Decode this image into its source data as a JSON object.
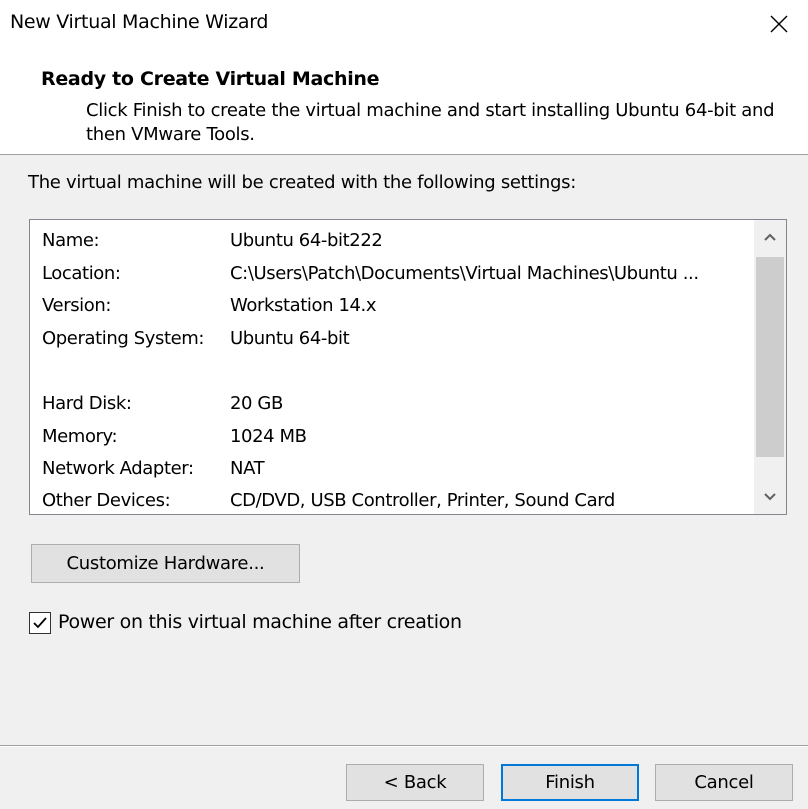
{
  "window": {
    "title": "New Virtual Machine Wizard",
    "close_icon": "close-icon"
  },
  "header": {
    "title": "Ready to Create Virtual Machine",
    "description": "Click Finish to create the virtual machine and start installing Ubuntu 64-bit and then VMware Tools."
  },
  "intro": "The virtual machine will be created with the following settings:",
  "settings": [
    {
      "label": "Name:",
      "value": "Ubuntu 64-bit222"
    },
    {
      "label": "Location:",
      "value": "C:\\Users\\Patch\\Documents\\Virtual Machines\\Ubuntu ..."
    },
    {
      "label": "Version:",
      "value": "Workstation 14.x"
    },
    {
      "label": "Operating System:",
      "value": "Ubuntu 64-bit"
    },
    {
      "label": "Hard Disk:",
      "value": "20 GB"
    },
    {
      "label": "Memory:",
      "value": "1024 MB"
    },
    {
      "label": "Network Adapter:",
      "value": "NAT"
    },
    {
      "label": "Other Devices:",
      "value": "CD/DVD, USB Controller, Printer, Sound Card"
    }
  ],
  "customize_button": "Customize Hardware...",
  "power_on": {
    "label": "Power on this virtual machine after creation",
    "checked": true
  },
  "buttons": {
    "back": "< Back",
    "finish": "Finish",
    "cancel": "Cancel"
  },
  "colors": {
    "accent": "#0078d7",
    "window_bg": "#f0f0f0",
    "panel_bg": "#ffffff"
  }
}
